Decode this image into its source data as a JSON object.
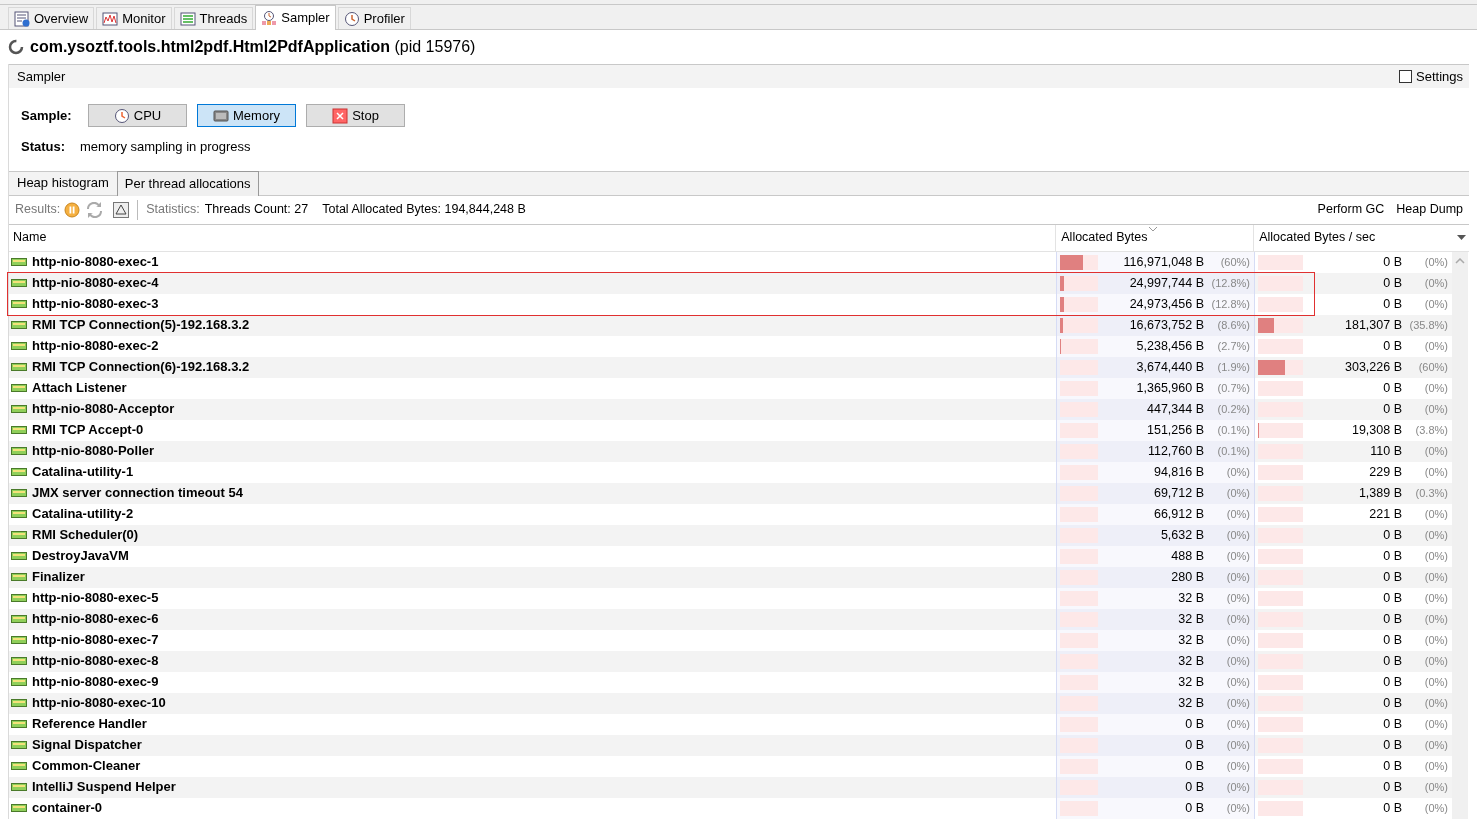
{
  "tabs": [
    {
      "label": "Overview",
      "selected": false
    },
    {
      "label": "Monitor",
      "selected": false
    },
    {
      "label": "Threads",
      "selected": false
    },
    {
      "label": "Sampler",
      "selected": true
    },
    {
      "label": "Profiler",
      "selected": false
    }
  ],
  "app": {
    "name": "com.ysoztf.tools.html2pdf.Html2PdfApplication",
    "pid": "(pid 15976)"
  },
  "panel": {
    "title": "Sampler",
    "settings": {
      "label": "Settings",
      "checked": false
    }
  },
  "sample": {
    "label": "Sample:",
    "buttons": [
      {
        "label": "CPU",
        "selected": false
      },
      {
        "label": "Memory",
        "selected": true
      },
      {
        "label": "Stop",
        "selected": false
      }
    ]
  },
  "status": {
    "label": "Status:",
    "value": "memory sampling in progress"
  },
  "subtabs": [
    {
      "label": "Heap histogram",
      "selected": false
    },
    {
      "label": "Per thread allocations",
      "selected": true
    }
  ],
  "toolbar": {
    "results": "Results:",
    "statistics": "Statistics:",
    "threads_count": "Threads Count: 27",
    "total": "Total Allocated Bytes: 194,844,248 B",
    "actions": [
      "Perform GC",
      "Heap Dump"
    ]
  },
  "table": {
    "columns": [
      "Name",
      "Allocated Bytes",
      "Allocated Bytes / sec"
    ],
    "rows": [
      {
        "name": "http-nio-8080-exec-1",
        "allocated": {
          "value": "116,971,048 B",
          "percent": "(60%)",
          "level": 0.6
        },
        "per_sec": {
          "value": "0 B",
          "percent": "(0%)"
        },
        "highlighted": false
      },
      {
        "name": "http-nio-8080-exec-4",
        "allocated": {
          "value": "24,997,744 B",
          "percent": "(12.8%)",
          "level": 0.1
        },
        "per_sec": {
          "value": "0 B",
          "percent": "(0%)"
        },
        "highlighted": true
      },
      {
        "name": "http-nio-8080-exec-3",
        "allocated": {
          "value": "24,973,456 B",
          "percent": "(12.8%)",
          "level": 0.1
        },
        "per_sec": {
          "value": "0 B",
          "percent": "(0%)"
        },
        "highlighted": true
      },
      {
        "name": "RMI TCP Connection(5)-192.168.3.2",
        "allocated": {
          "value": "16,673,752 B",
          "percent": "(8.6%)",
          "level": 0.07
        },
        "per_sec": {
          "value": "181,307 B",
          "percent": "(35.8%)",
          "level": 0.358
        },
        "highlighted": false
      },
      {
        "name": "http-nio-8080-exec-2",
        "allocated": {
          "value": "5,238,456 B",
          "percent": "(2.7%)",
          "level": 0.03
        },
        "per_sec": {
          "value": "0 B",
          "percent": "(0%)"
        },
        "highlighted": false
      },
      {
        "name": "RMI TCP Connection(6)-192.168.3.2",
        "allocated": {
          "value": "3,674,440 B",
          "percent": "(1.9%)"
        },
        "per_sec": {
          "value": "303,226 B",
          "percent": "(60%)",
          "level": 0.6
        },
        "highlighted": false
      },
      {
        "name": "Attach Listener",
        "allocated": {
          "value": "1,365,960 B",
          "percent": "(0.7%)"
        },
        "per_sec": {
          "value": "0 B",
          "percent": "(0%)"
        },
        "highlighted": false
      },
      {
        "name": "http-nio-8080-Acceptor",
        "allocated": {
          "value": "447,344 B",
          "percent": "(0.2%)"
        },
        "per_sec": {
          "value": "0 B",
          "percent": "(0%)"
        },
        "highlighted": false
      },
      {
        "name": "RMI TCP Accept-0",
        "allocated": {
          "value": "151,256 B",
          "percent": "(0.1%)"
        },
        "per_sec": {
          "value": "19,308 B",
          "percent": "(3.8%)",
          "level": 0.03
        },
        "highlighted": false
      },
      {
        "name": "http-nio-8080-Poller",
        "allocated": {
          "value": "112,760 B",
          "percent": "(0.1%)"
        },
        "per_sec": {
          "value": "110 B",
          "percent": "(0%)"
        },
        "highlighted": false
      },
      {
        "name": "Catalina-utility-1",
        "allocated": {
          "value": "94,816 B",
          "percent": "(0%)"
        },
        "per_sec": {
          "value": "229 B",
          "percent": "(0%)"
        },
        "highlighted": false
      },
      {
        "name": "JMX server connection timeout 54",
        "allocated": {
          "value": "69,712 B",
          "percent": "(0%)"
        },
        "per_sec": {
          "value": "1,389 B",
          "percent": "(0.3%)"
        },
        "highlighted": false
      },
      {
        "name": "Catalina-utility-2",
        "allocated": {
          "value": "66,912 B",
          "percent": "(0%)"
        },
        "per_sec": {
          "value": "221 B",
          "percent": "(0%)"
        },
        "highlighted": false
      },
      {
        "name": "RMI Scheduler(0)",
        "allocated": {
          "value": "5,632 B",
          "percent": "(0%)"
        },
        "per_sec": {
          "value": "0 B",
          "percent": "(0%)"
        },
        "highlighted": false
      },
      {
        "name": "DestroyJavaVM",
        "allocated": {
          "value": "488 B",
          "percent": "(0%)"
        },
        "per_sec": {
          "value": "0 B",
          "percent": "(0%)"
        },
        "highlighted": false
      },
      {
        "name": "Finalizer",
        "allocated": {
          "value": "280 B",
          "percent": "(0%)"
        },
        "per_sec": {
          "value": "0 B",
          "percent": "(0%)"
        },
        "highlighted": false
      },
      {
        "name": "http-nio-8080-exec-5",
        "allocated": {
          "value": "32 B",
          "percent": "(0%)"
        },
        "per_sec": {
          "value": "0 B",
          "percent": "(0%)"
        },
        "highlighted": false
      },
      {
        "name": "http-nio-8080-exec-6",
        "allocated": {
          "value": "32 B",
          "percent": "(0%)"
        },
        "per_sec": {
          "value": "0 B",
          "percent": "(0%)"
        },
        "highlighted": false
      },
      {
        "name": "http-nio-8080-exec-7",
        "allocated": {
          "value": "32 B",
          "percent": "(0%)"
        },
        "per_sec": {
          "value": "0 B",
          "percent": "(0%)"
        },
        "highlighted": false
      },
      {
        "name": "http-nio-8080-exec-8",
        "allocated": {
          "value": "32 B",
          "percent": "(0%)"
        },
        "per_sec": {
          "value": "0 B",
          "percent": "(0%)"
        },
        "highlighted": false
      },
      {
        "name": "http-nio-8080-exec-9",
        "allocated": {
          "value": "32 B",
          "percent": "(0%)"
        },
        "per_sec": {
          "value": "0 B",
          "percent": "(0%)"
        },
        "highlighted": false
      },
      {
        "name": "http-nio-8080-exec-10",
        "allocated": {
          "value": "32 B",
          "percent": "(0%)"
        },
        "per_sec": {
          "value": "0 B",
          "percent": "(0%)"
        },
        "highlighted": false
      },
      {
        "name": "Reference Handler",
        "allocated": {
          "value": "0 B",
          "percent": "(0%)"
        },
        "per_sec": {
          "value": "0 B",
          "percent": "(0%)"
        },
        "highlighted": false
      },
      {
        "name": "Signal Dispatcher",
        "allocated": {
          "value": "0 B",
          "percent": "(0%)"
        },
        "per_sec": {
          "value": "0 B",
          "percent": "(0%)"
        },
        "highlighted": false
      },
      {
        "name": "Common-Cleaner",
        "allocated": {
          "value": "0 B",
          "percent": "(0%)"
        },
        "per_sec": {
          "value": "0 B",
          "percent": "(0%)"
        },
        "highlighted": false
      },
      {
        "name": "IntelliJ Suspend Helper",
        "allocated": {
          "value": "0 B",
          "percent": "(0%)"
        },
        "per_sec": {
          "value": "0 B",
          "percent": "(0%)"
        },
        "highlighted": false
      },
      {
        "name": "container-0",
        "allocated": {
          "value": "0 B",
          "percent": "(0%)"
        },
        "per_sec": {
          "value": "0 B",
          "percent": "(0%)"
        },
        "highlighted": false
      }
    ]
  }
}
